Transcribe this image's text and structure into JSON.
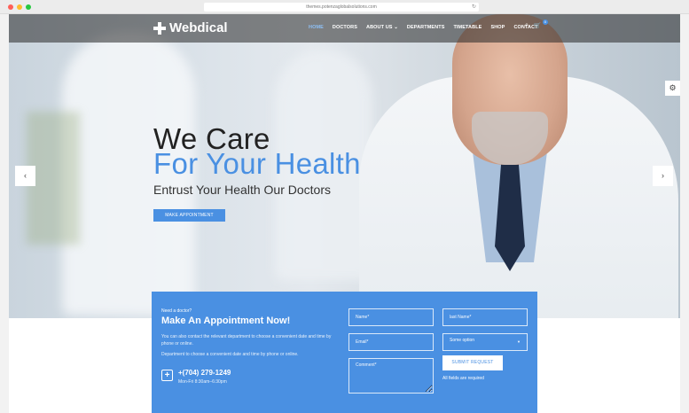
{
  "browser": {
    "url": "themes.potenzaglobalsolutions.com"
  },
  "header": {
    "logo": "Webdical",
    "nav": [
      {
        "label": "HOME",
        "active": true
      },
      {
        "label": "DOCTORS",
        "active": false
      },
      {
        "label": "ABOUT US",
        "active": false,
        "dropdown": true
      },
      {
        "label": "DEPARTMENTS",
        "active": false
      },
      {
        "label": "TIMETABLE",
        "active": false
      },
      {
        "label": "SHOP",
        "active": false
      },
      {
        "label": "CONTACT",
        "active": false
      }
    ],
    "cart_count": "0"
  },
  "hero": {
    "line1": "We Care",
    "line2": "For Your Health",
    "tagline": "Entrust Your Health Our Doctors",
    "button": "MAKE APPOINTMENT"
  },
  "appointment": {
    "question": "Need a doctor?",
    "title": "Make An Appointment Now!",
    "text1": "You can also contact the relevant department to choose a convenient date and time by phone or online.",
    "text2": "Department to choose a convenient date and time by phone or online.",
    "phone": "+(704) 279-1249",
    "hours": "Mon-Fri 8:30am–6:30pm",
    "placeholders": {
      "name": "Name*",
      "last_name": "last Name*",
      "email": "Email*",
      "select": "Some option",
      "comment": "Comment*"
    },
    "submit": "SUBMIT REQUEST",
    "required_note": "All fields are required"
  },
  "colors": {
    "accent": "#4a90e2",
    "header_overlay": "#282828",
    "active_nav": "#8ec0f5"
  },
  "icons": {
    "search": "search-icon",
    "cart": "cart-icon",
    "settings": "gear-icon",
    "prev": "chevron-left-icon",
    "next": "chevron-right-icon",
    "phone": "plus-cross-icon"
  }
}
